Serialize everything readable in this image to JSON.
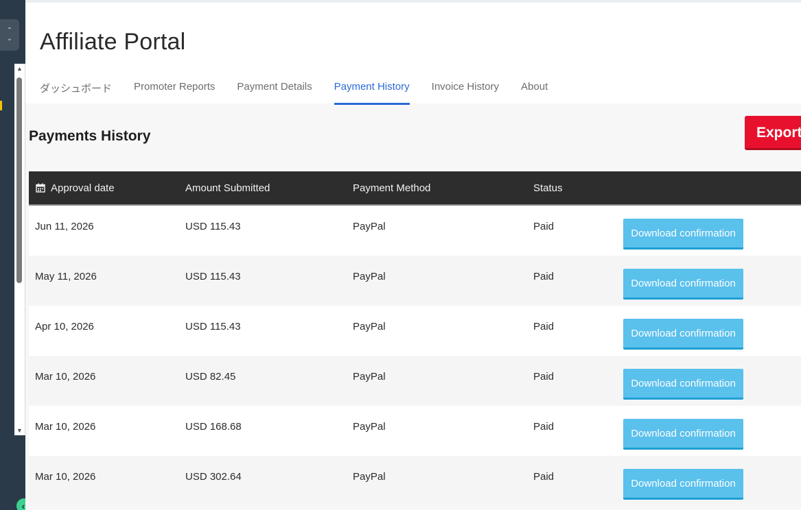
{
  "app": {
    "title": "Affiliate Portal"
  },
  "tabs": [
    {
      "label": "ダッシュボード",
      "active": false
    },
    {
      "label": "Promoter Reports",
      "active": false
    },
    {
      "label": "Payment Details",
      "active": false
    },
    {
      "label": "Payment History",
      "active": true
    },
    {
      "label": "Invoice History",
      "active": false
    },
    {
      "label": "About",
      "active": false
    }
  ],
  "page": {
    "heading": "Payments History",
    "export_label": "Export"
  },
  "table": {
    "columns": [
      "Approval date",
      "Amount Submitted",
      "Payment Method",
      "Status"
    ],
    "rows": [
      {
        "date": "Jun 11, 2026",
        "amount": "USD 115.43",
        "method": "PayPal",
        "status": "Paid",
        "action": "Download confirmation"
      },
      {
        "date": "May 11, 2026",
        "amount": "USD 115.43",
        "method": "PayPal",
        "status": "Paid",
        "action": "Download confirmation"
      },
      {
        "date": "Apr 10, 2026",
        "amount": "USD 115.43",
        "method": "PayPal",
        "status": "Paid",
        "action": "Download confirmation"
      },
      {
        "date": "Mar 10, 2026",
        "amount": "USD 82.45",
        "method": "PayPal",
        "status": "Paid",
        "action": "Download confirmation"
      },
      {
        "date": "Mar 10, 2026",
        "amount": "USD 168.68",
        "method": "PayPal",
        "status": "Paid",
        "action": "Download confirmation"
      },
      {
        "date": "Mar 10, 2026",
        "amount": "USD 302.64",
        "method": "PayPal",
        "status": "Paid",
        "action": "Download confirmation"
      }
    ]
  },
  "icons": {
    "calendar": "calendar-icon",
    "sidebar_toggle": "chevron-up-down-icon",
    "back": "chevron-left-icon"
  },
  "colors": {
    "accent": "#2a6ad8",
    "export": "#e8112d",
    "download": "#5ac0ec",
    "table_header": "#2d2d2d",
    "sidebar": "#2b3a48"
  }
}
